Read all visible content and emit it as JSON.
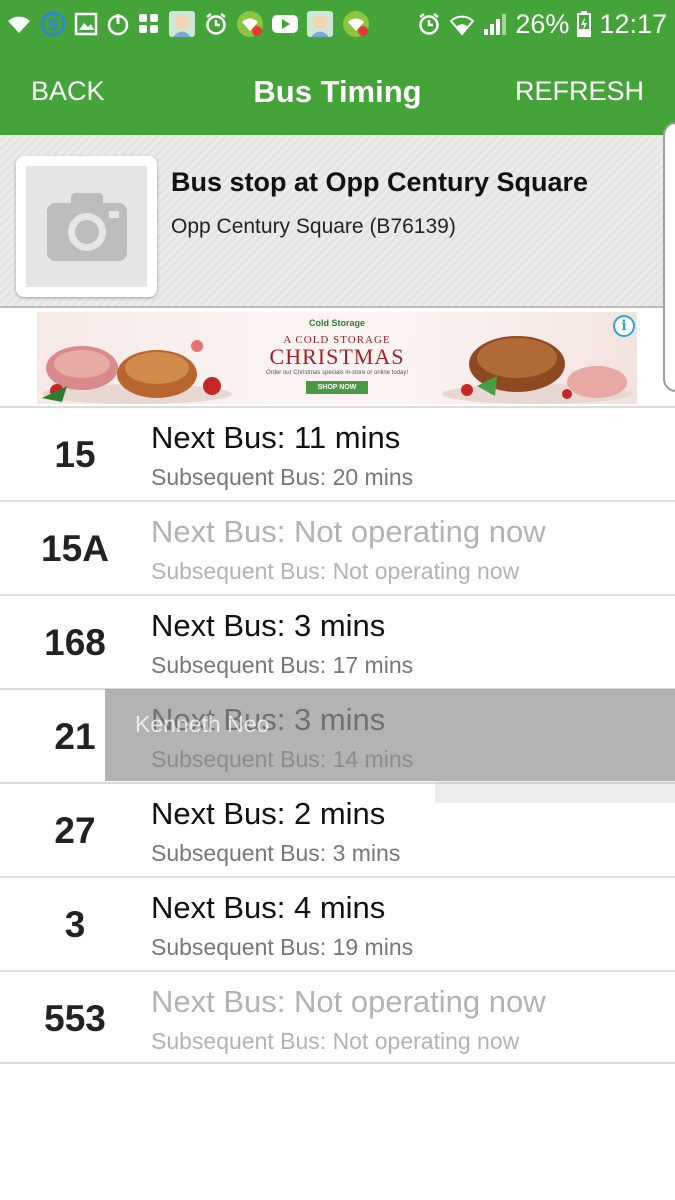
{
  "status_bar": {
    "battery": "26%",
    "time": "12:17",
    "icons": [
      "wifi-icon",
      "sync-icon",
      "gallery-icon",
      "power-icon",
      "apps-icon",
      "avatar-icon",
      "alarm-icon",
      "wifi-alert-icon",
      "youtube-icon",
      "avatar-icon",
      "wifi-alert-icon",
      "alarm-icon",
      "wifi-icon",
      "signal-icon",
      "battery-icon"
    ]
  },
  "app_bar": {
    "back_label": "BACK",
    "title": "Bus Timing",
    "refresh_label": "REFRESH",
    "color": "#44a43a"
  },
  "stop": {
    "name": "Bus stop at Opp Century Square",
    "code": "Opp Century Square (B76139)",
    "photo_icon": "camera-icon"
  },
  "ad": {
    "brand": "Cold Storage",
    "line1": "A COLD STORAGE",
    "line2": "CHRISTMAS",
    "subtext": "Order our Christmas specials in-store or online today!",
    "cta": "SHOP NOW",
    "info_icon": "info-icon"
  },
  "buses": [
    {
      "number": "15",
      "next": "Next Bus: 11 mins",
      "subsequent": "Subsequent Bus: 20 mins",
      "operating": true
    },
    {
      "number": "15A",
      "next": "Next Bus: Not operating now",
      "subsequent": "Subsequent Bus: Not operating now",
      "operating": false
    },
    {
      "number": "168",
      "next": "Next Bus: 3 mins",
      "subsequent": "Subsequent Bus: 17 mins",
      "operating": true
    },
    {
      "number": "21",
      "next": "Next Bus: 3 mins",
      "subsequent": "Subsequent Bus: 14 mins",
      "operating": true
    },
    {
      "number": "27",
      "next": "Next Bus: 2 mins",
      "subsequent": "Subsequent Bus: 3 mins",
      "operating": true
    },
    {
      "number": "3",
      "next": "Next Bus: 4 mins",
      "subsequent": "Subsequent Bus: 19 mins",
      "operating": true
    },
    {
      "number": "553",
      "next": "Next Bus: Not operating now",
      "subsequent": "Subsequent Bus: Not operating now",
      "operating": false
    }
  ],
  "toast": {
    "text": "Kenneth Neo"
  }
}
